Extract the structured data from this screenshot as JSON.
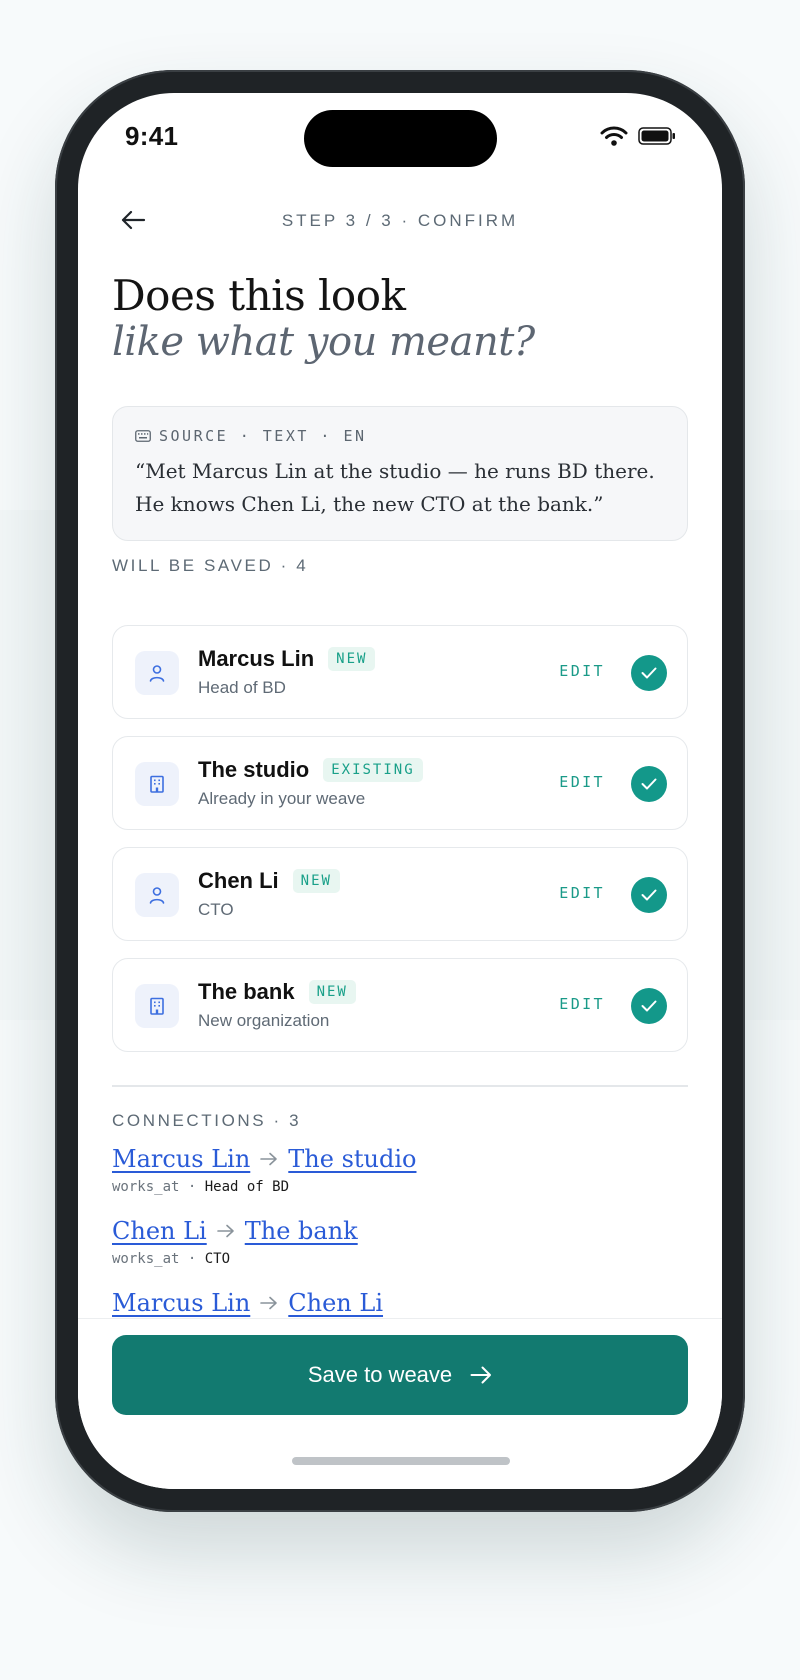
{
  "status": {
    "time": "9:41"
  },
  "header": {
    "step_label": "STEP 3 / 3 · CONFIRM"
  },
  "title": {
    "line1": "Does this look",
    "line2": "like what you meant?"
  },
  "source": {
    "label": "SOURCE · TEXT · EN",
    "quote": "“Met Marcus Lin at the studio — he runs BD there. He knows Chen Li, the new CTO at the bank.”"
  },
  "saved": {
    "label": "WILL BE SAVED · 4",
    "edit_label": "EDIT",
    "items": [
      {
        "name": "Marcus Lin",
        "badge": "NEW",
        "sub": "Head of BD",
        "icon": "person-icon"
      },
      {
        "name": "The studio",
        "badge": "EXISTING",
        "sub": "Already in your weave",
        "icon": "building-icon"
      },
      {
        "name": "Chen Li",
        "badge": "NEW",
        "sub": "CTO",
        "icon": "person-icon"
      },
      {
        "name": "The bank",
        "badge": "NEW",
        "sub": "New organization",
        "icon": "building-icon"
      }
    ]
  },
  "connections": {
    "label": "CONNECTIONS · 3",
    "separator": " · ",
    "items": [
      {
        "from": "Marcus Lin",
        "to": "The studio",
        "relation": "works_at",
        "attr": "Head of BD"
      },
      {
        "from": "Chen Li",
        "to": "The bank",
        "relation": "works_at",
        "attr": "CTO"
      },
      {
        "from": "Marcus Lin",
        "to": "Chen Li",
        "relation": "",
        "attr": ""
      }
    ]
  },
  "footer": {
    "save_label": "Save to weave"
  },
  "colors": {
    "accent": "#127a70",
    "check": "#13988a",
    "link": "#2a5bd7",
    "badge_text": "#19a089"
  }
}
